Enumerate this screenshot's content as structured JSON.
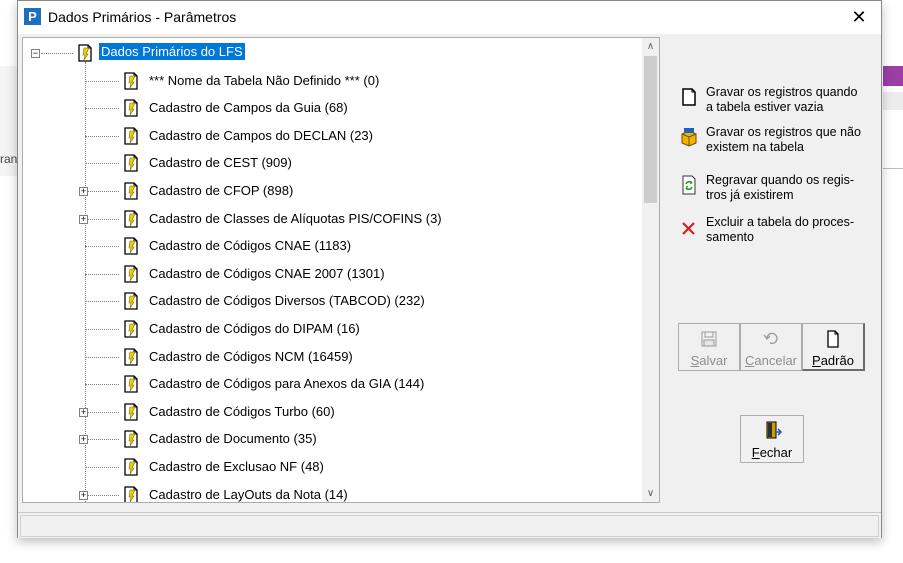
{
  "window": {
    "title": "Dados Primários - Parâmetros",
    "close_glyph": "✕"
  },
  "background_app": {
    "fragment_text": "ran"
  },
  "tree": {
    "root": {
      "label": "Dados Primários do LFS",
      "expanded": true
    },
    "items": [
      {
        "label": "*** Nome da Tabela Não Definido *** (0)",
        "expandable": false
      },
      {
        "label": "Cadastro de Campos da Guia (68)",
        "expandable": false
      },
      {
        "label": "Cadastro de Campos do DECLAN (23)",
        "expandable": false
      },
      {
        "label": "Cadastro de CEST (909)",
        "expandable": false
      },
      {
        "label": "Cadastro de CFOP (898)",
        "expandable": true
      },
      {
        "label": "Cadastro de Classes de Alíquotas PIS/COFINS (3)",
        "expandable": true
      },
      {
        "label": "Cadastro de Códigos CNAE (1183)",
        "expandable": false
      },
      {
        "label": "Cadastro de Códigos CNAE 2007 (1301)",
        "expandable": false
      },
      {
        "label": "Cadastro de Códigos Diversos (TABCOD) (232)",
        "expandable": false
      },
      {
        "label": "Cadastro de Códigos do DIPAM (16)",
        "expandable": false
      },
      {
        "label": "Cadastro de Códigos NCM (16459)",
        "expandable": false
      },
      {
        "label": "Cadastro de Códigos para Anexos da GIA (144)",
        "expandable": false
      },
      {
        "label": "Cadastro de Códigos Turbo (60)",
        "expandable": true
      },
      {
        "label": "Cadastro de Documento (35)",
        "expandable": true
      },
      {
        "label": "Cadastro de Exclusao NF (48)",
        "expandable": false
      },
      {
        "label": "Cadastro de LayOuts da Nota (14)",
        "expandable": true
      }
    ]
  },
  "legend": {
    "gravar_vazia": {
      "line1": "Gravar os registros quando",
      "line2": "a tabela estiver vazia",
      "icon": "new-document-icon"
    },
    "gravar_nao_existem": {
      "line1": "Gravar os registros que não",
      "line2": "existem na tabela",
      "icon": "box-icon"
    },
    "regravar": {
      "line1": "Regravar quando os regis-",
      "line2": "tros já existirem",
      "icon": "refresh-document-icon"
    },
    "excluir": {
      "line1": "Excluir a tabela do proces-",
      "line2": "samento",
      "icon": "red-x-icon",
      "color": "#d42020"
    }
  },
  "buttons": {
    "salvar": {
      "label": "Salvar",
      "accel": "S",
      "rest": "alvar",
      "enabled": false
    },
    "cancelar": {
      "label": "Cancelar",
      "accel": "C",
      "rest": "ancelar",
      "enabled": false
    },
    "padrao": {
      "label": "Padrão",
      "accel": "P",
      "rest": "adrão",
      "enabled": true
    },
    "fechar": {
      "label": "Fechar",
      "accel": "F",
      "rest": "echar",
      "enabled": true
    }
  },
  "colors": {
    "selection": "#0078d7",
    "app_icon": "#1f6fbf",
    "accent_purple": "#9b3ea6"
  }
}
